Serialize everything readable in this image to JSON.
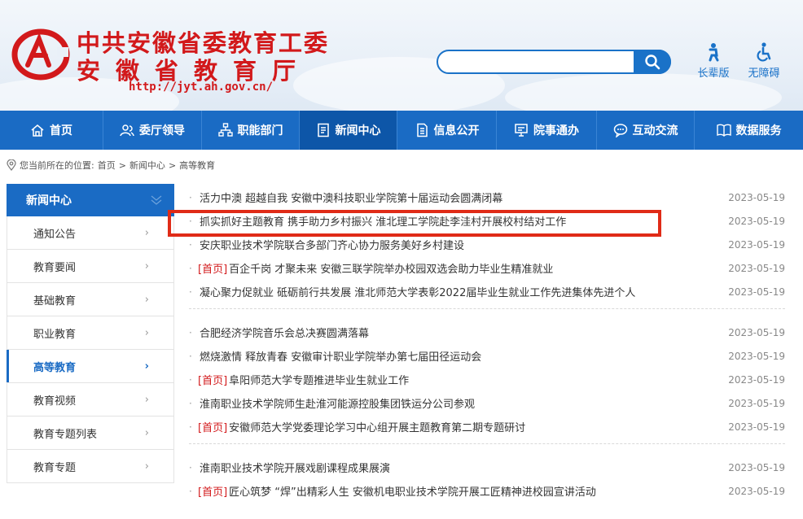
{
  "header": {
    "title_line1": "中共安徽省委教育工委",
    "title_line2": "安徽省教育厅",
    "url": "http://jyt.ah.gov.cn/",
    "search_placeholder": "",
    "tools": [
      {
        "label": "长辈版",
        "icon": "elder-icon"
      },
      {
        "label": "无障碍",
        "icon": "accessibility-icon"
      }
    ],
    "brand_color": "#d2191b",
    "accent_color": "#1a6bc4"
  },
  "nav": [
    {
      "label": "首页",
      "icon": "home-icon"
    },
    {
      "label": "委厅领导",
      "icon": "leaders-icon"
    },
    {
      "label": "职能部门",
      "icon": "org-chart-icon"
    },
    {
      "label": "新闻中心",
      "icon": "news-icon",
      "active": true
    },
    {
      "label": "信息公开",
      "icon": "document-icon"
    },
    {
      "label": "院事通办",
      "icon": "monitor-icon"
    },
    {
      "label": "互动交流",
      "icon": "chat-icon"
    },
    {
      "label": "数据服务",
      "icon": "book-icon"
    }
  ],
  "breadcrumb": {
    "prefix": "您当前所在的位置:",
    "items": [
      "首页",
      "新闻中心",
      "高等教育"
    ],
    "separator": ">"
  },
  "sidebar": {
    "title": "新闻中心",
    "items": [
      {
        "label": "通知公告",
        "active": false
      },
      {
        "label": "教育要闻",
        "active": false
      },
      {
        "label": "基础教育",
        "active": false
      },
      {
        "label": "职业教育",
        "active": false
      },
      {
        "label": "高等教育",
        "active": true
      },
      {
        "label": "教育视频",
        "active": false
      },
      {
        "label": "教育专题列表",
        "active": false
      },
      {
        "label": "教育专题",
        "active": false
      }
    ]
  },
  "news_groups": [
    [
      {
        "tag": "",
        "title": "活力中澳 超越自我 安徽中澳科技职业学院第十届运动会圆满闭幕",
        "date": "2023-05-19"
      },
      {
        "tag": "",
        "title": "抓实抓好主题教育 携手助力乡村振兴 淮北理工学院赴李洼村开展校村结对工作",
        "date": "2023-05-19"
      },
      {
        "tag": "",
        "title": "安庆职业技术学院联合多部门齐心协力服务美好乡村建设",
        "date": "2023-05-19"
      },
      {
        "tag": "[首页]",
        "title": "百企千岗 才聚未来 安徽三联学院举办校园双选会助力毕业生精准就业",
        "date": "2023-05-19"
      },
      {
        "tag": "",
        "title": "凝心聚力促就业 砥砺前行共发展 淮北师范大学表彰2022届毕业生就业工作先进集体先进个人",
        "date": "2023-05-19"
      }
    ],
    [
      {
        "tag": "",
        "title": "合肥经济学院音乐会总决赛圆满落幕",
        "date": "2023-05-19"
      },
      {
        "tag": "",
        "title": "燃烧激情 释放青春 安徽审计职业学院举办第七届田径运动会",
        "date": "2023-05-19"
      },
      {
        "tag": "[首页]",
        "title": "阜阳师范大学专题推进毕业生就业工作",
        "date": "2023-05-19"
      },
      {
        "tag": "",
        "title": "淮南职业技术学院师生赴淮河能源控股集团铁运分公司参观",
        "date": "2023-05-19"
      },
      {
        "tag": "[首页]",
        "title": "安徽师范大学党委理论学习中心组开展主题教育第二期专题研讨",
        "date": "2023-05-19"
      }
    ],
    [
      {
        "tag": "",
        "title": "淮南职业技术学院开展戏剧课程成果展演",
        "date": "2023-05-19"
      },
      {
        "tag": "[首页]",
        "title": "匠心筑梦 “焊”出精彩人生 安徽机电职业技术学院开展工匠精神进校园宣讲活动",
        "date": "2023-05-19"
      }
    ]
  ]
}
